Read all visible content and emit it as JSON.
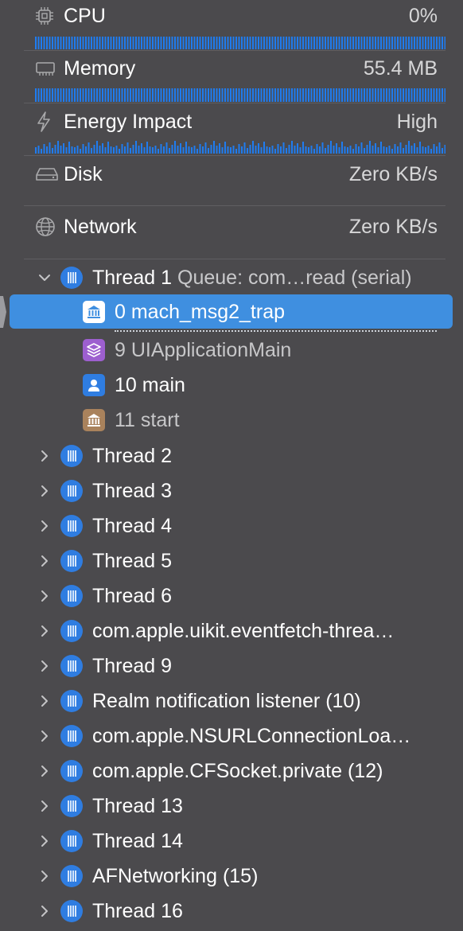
{
  "gauges": [
    {
      "label": "CPU",
      "value": "0%",
      "icon": "cpu-chip-icon"
    },
    {
      "label": "Memory",
      "value": "55.4 MB",
      "icon": "memory-module-icon"
    },
    {
      "label": "Energy Impact",
      "value": "High",
      "icon": "lightning-bolt-icon"
    },
    {
      "label": "Disk",
      "value": "Zero KB/s",
      "icon": "disk-drive-icon"
    },
    {
      "label": "Network",
      "value": "Zero KB/s",
      "icon": "globe-icon"
    }
  ],
  "colors": {
    "background": "#4b4a4d",
    "accent": "#2f7de1",
    "selection": "#3f8fe0",
    "bar_blue": "#1f7cf0"
  },
  "threads": {
    "expanded": {
      "name": "Thread 1",
      "queue": "Queue: com…read (serial)",
      "frames": [
        {
          "label": "0 mach_msg2_trap",
          "icon": "system-library-icon",
          "selected": true
        },
        {
          "label": "9 UIApplicationMain",
          "icon": "framework-stack-icon",
          "selected": false
        },
        {
          "label": "10 main",
          "icon": "user-code-icon",
          "selected": false
        },
        {
          "label": "11 start",
          "icon": "system-library-icon",
          "selected": false
        }
      ]
    },
    "collapsed": [
      "Thread 2",
      "Thread 3",
      "Thread 4",
      "Thread 5",
      "Thread 6",
      "com.apple.uikit.eventfetch-threa…",
      "Thread 9",
      "Realm notification listener (10)",
      "com.apple.NSURLConnectionLoa…",
      "com.apple.CFSocket.private (12)",
      "Thread 13",
      "Thread 14",
      "AFNetworking (15)",
      "Thread 16"
    ]
  }
}
